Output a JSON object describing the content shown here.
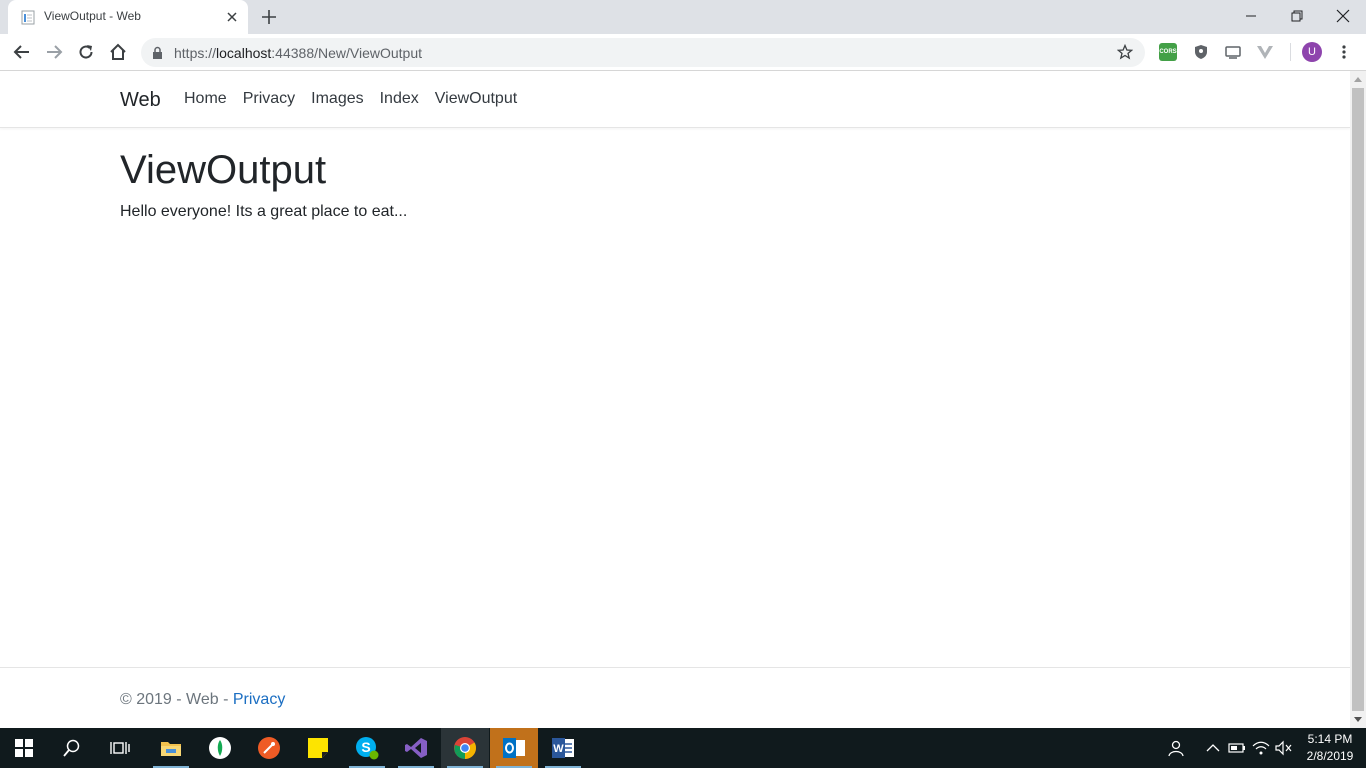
{
  "browser": {
    "tab_title": "ViewOutput - Web",
    "url_prefix": "https://",
    "url_host": "localhost",
    "url_rest": ":44388/New/ViewOutput",
    "avatar_letter": "U",
    "extension_cors_label": "CORS"
  },
  "site": {
    "brand": "Web",
    "nav": [
      "Home",
      "Privacy",
      "Images",
      "Index",
      "ViewOutput"
    ]
  },
  "main": {
    "heading": "ViewOutput",
    "text": "Hello everyone! Its a great place to eat..."
  },
  "footer": {
    "text": "© 2019 - Web - ",
    "link": "Privacy"
  },
  "taskbar": {
    "time": "5:14 PM",
    "date": "2/8/2019",
    "apps": [
      "start-icon",
      "search-icon",
      "task-view-icon",
      "file-explorer-icon",
      "mongodb-compass-icon",
      "postman-icon",
      "sticky-notes-icon",
      "skype-icon",
      "visual-studio-icon",
      "chrome-icon",
      "outlook-icon",
      "word-icon"
    ]
  },
  "colors": {
    "link": "#1b6ec2",
    "taskbar": "#101a1d",
    "tabstrip": "#dee1e6"
  }
}
